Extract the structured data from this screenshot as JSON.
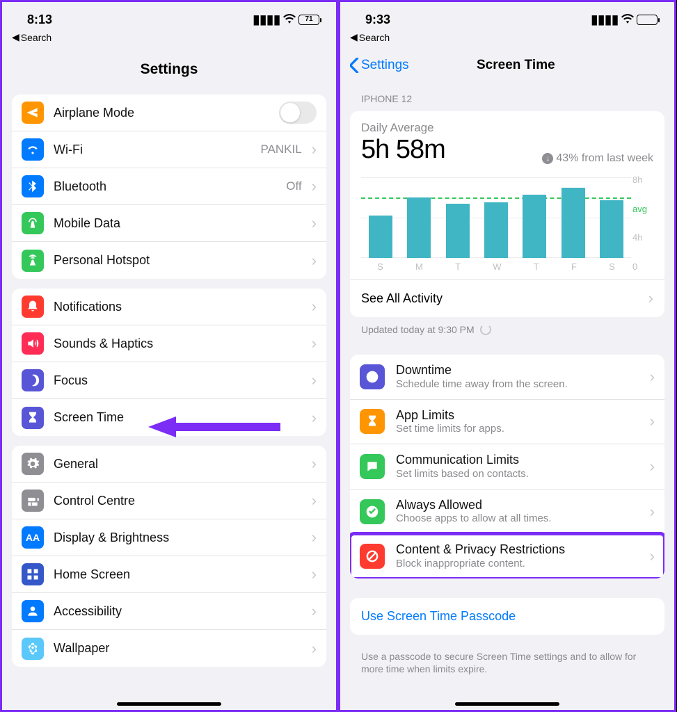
{
  "left": {
    "status": {
      "time": "8:13",
      "battery_pct": "71",
      "back": "Search"
    },
    "title": "Settings",
    "groups": [
      [
        {
          "icon": "airplane-icon",
          "bg": "#ff9500",
          "label": "Airplane Mode",
          "toggle": true
        },
        {
          "icon": "wifi-icon",
          "bg": "#007aff",
          "label": "Wi-Fi",
          "value": "PANKIL"
        },
        {
          "icon": "bluetooth-icon",
          "bg": "#007aff",
          "label": "Bluetooth",
          "value": "Off"
        },
        {
          "icon": "antenna-icon",
          "bg": "#34c759",
          "label": "Mobile Data"
        },
        {
          "icon": "hotspot-icon",
          "bg": "#34c759",
          "label": "Personal Hotspot"
        }
      ],
      [
        {
          "icon": "bell-icon",
          "bg": "#ff3b30",
          "label": "Notifications"
        },
        {
          "icon": "speaker-icon",
          "bg": "#ff2d55",
          "label": "Sounds & Haptics"
        },
        {
          "icon": "moon-icon",
          "bg": "#5856d6",
          "label": "Focus"
        },
        {
          "icon": "hourglass-icon",
          "bg": "#5856d6",
          "label": "Screen Time",
          "annot": true
        }
      ],
      [
        {
          "icon": "gear-icon",
          "bg": "#8e8e93",
          "label": "General"
        },
        {
          "icon": "switches-icon",
          "bg": "#8e8e93",
          "label": "Control Centre"
        },
        {
          "icon": "aa-icon",
          "bg": "#007aff",
          "label": "Display & Brightness"
        },
        {
          "icon": "grid-icon",
          "bg": "#3558c8",
          "label": "Home Screen"
        },
        {
          "icon": "person-icon",
          "bg": "#007aff",
          "label": "Accessibility"
        },
        {
          "icon": "flower-icon",
          "bg": "#5ac8fa",
          "label": "Wallpaper"
        }
      ]
    ]
  },
  "right": {
    "status": {
      "time": "9:33",
      "back": "Search"
    },
    "nav": {
      "back": "Settings",
      "title": "Screen Time"
    },
    "device_header": "IPHONE 12",
    "daily": {
      "label": "Daily Average",
      "value": "5h 58m",
      "delta": "43% from last week"
    },
    "see_all": "See All Activity",
    "updated": "Updated today at 9:30 PM",
    "opts": [
      {
        "icon": "downtime-icon",
        "bg": "#5856d6",
        "title": "Downtime",
        "sub": "Schedule time away from the screen."
      },
      {
        "icon": "hourglass-icon",
        "bg": "#ff9500",
        "title": "App Limits",
        "sub": "Set time limits for apps."
      },
      {
        "icon": "chat-icon",
        "bg": "#34c759",
        "title": "Communication Limits",
        "sub": "Set limits based on contacts."
      },
      {
        "icon": "check-icon",
        "bg": "#34c759",
        "title": "Always Allowed",
        "sub": "Choose apps to allow at all times."
      },
      {
        "icon": "block-icon",
        "bg": "#ff3b30",
        "title": "Content & Privacy Restrictions",
        "sub": "Block inappropriate content.",
        "highlight": true
      }
    ],
    "passcode": "Use Screen Time Passcode",
    "footer": "Use a passcode to secure Screen Time settings and to allow for more time when limits expire."
  },
  "chart_data": {
    "type": "bar",
    "categories": [
      "S",
      "M",
      "T",
      "W",
      "T",
      "F",
      "S"
    ],
    "values": [
      4.2,
      6.0,
      5.4,
      5.5,
      6.3,
      7.0,
      5.7
    ],
    "ylabel": "",
    "xlabel": "",
    "ylim": [
      0,
      8
    ],
    "avg": 5.97,
    "y_ticks": [
      "8h",
      "avg",
      "4h",
      "0"
    ],
    "title": "Daily Average 5h 58m"
  }
}
